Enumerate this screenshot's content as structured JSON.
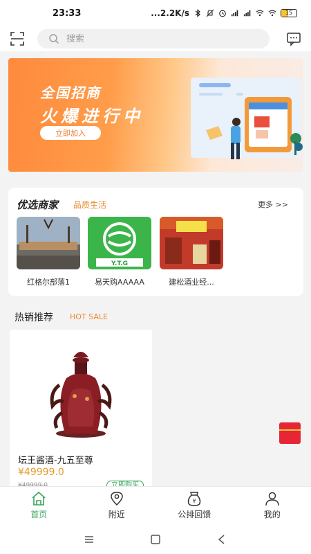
{
  "status_bar": {
    "time": "23:33",
    "net_speed": "...2.2K/s",
    "battery": "15"
  },
  "search": {
    "placeholder": "搜索"
  },
  "banner": {
    "title_line1": "全国招商",
    "title_line2": "火爆进行中",
    "button_label": "立即加入"
  },
  "featured_merchants": {
    "title": "优选商家",
    "subtitle": "品质生活",
    "more_label": "更多 >>",
    "items": [
      {
        "name": "红格尔部落1"
      },
      {
        "name": "易天购AAAAA"
      },
      {
        "name": "建松酒业经..."
      }
    ]
  },
  "hot_sale": {
    "title": "热销推荐",
    "subtitle": "HOT SALE",
    "product": {
      "name": "坛王酱酒-九五至尊",
      "price": "¥49999.0",
      "original_price": "¥49999.0",
      "buy_label": "立即购买"
    }
  },
  "tabbar": {
    "items": [
      {
        "label": "首页",
        "icon": "home-icon",
        "active": true
      },
      {
        "label": "附近",
        "icon": "location-icon",
        "active": false
      },
      {
        "label": "公排回馈",
        "icon": "money-bag-icon",
        "active": false
      },
      {
        "label": "我的",
        "icon": "person-icon",
        "active": false
      }
    ]
  },
  "colors": {
    "accent": "#3aa55a",
    "highlight": "#e88a2c",
    "banner_orange": "#ff8a3d"
  }
}
